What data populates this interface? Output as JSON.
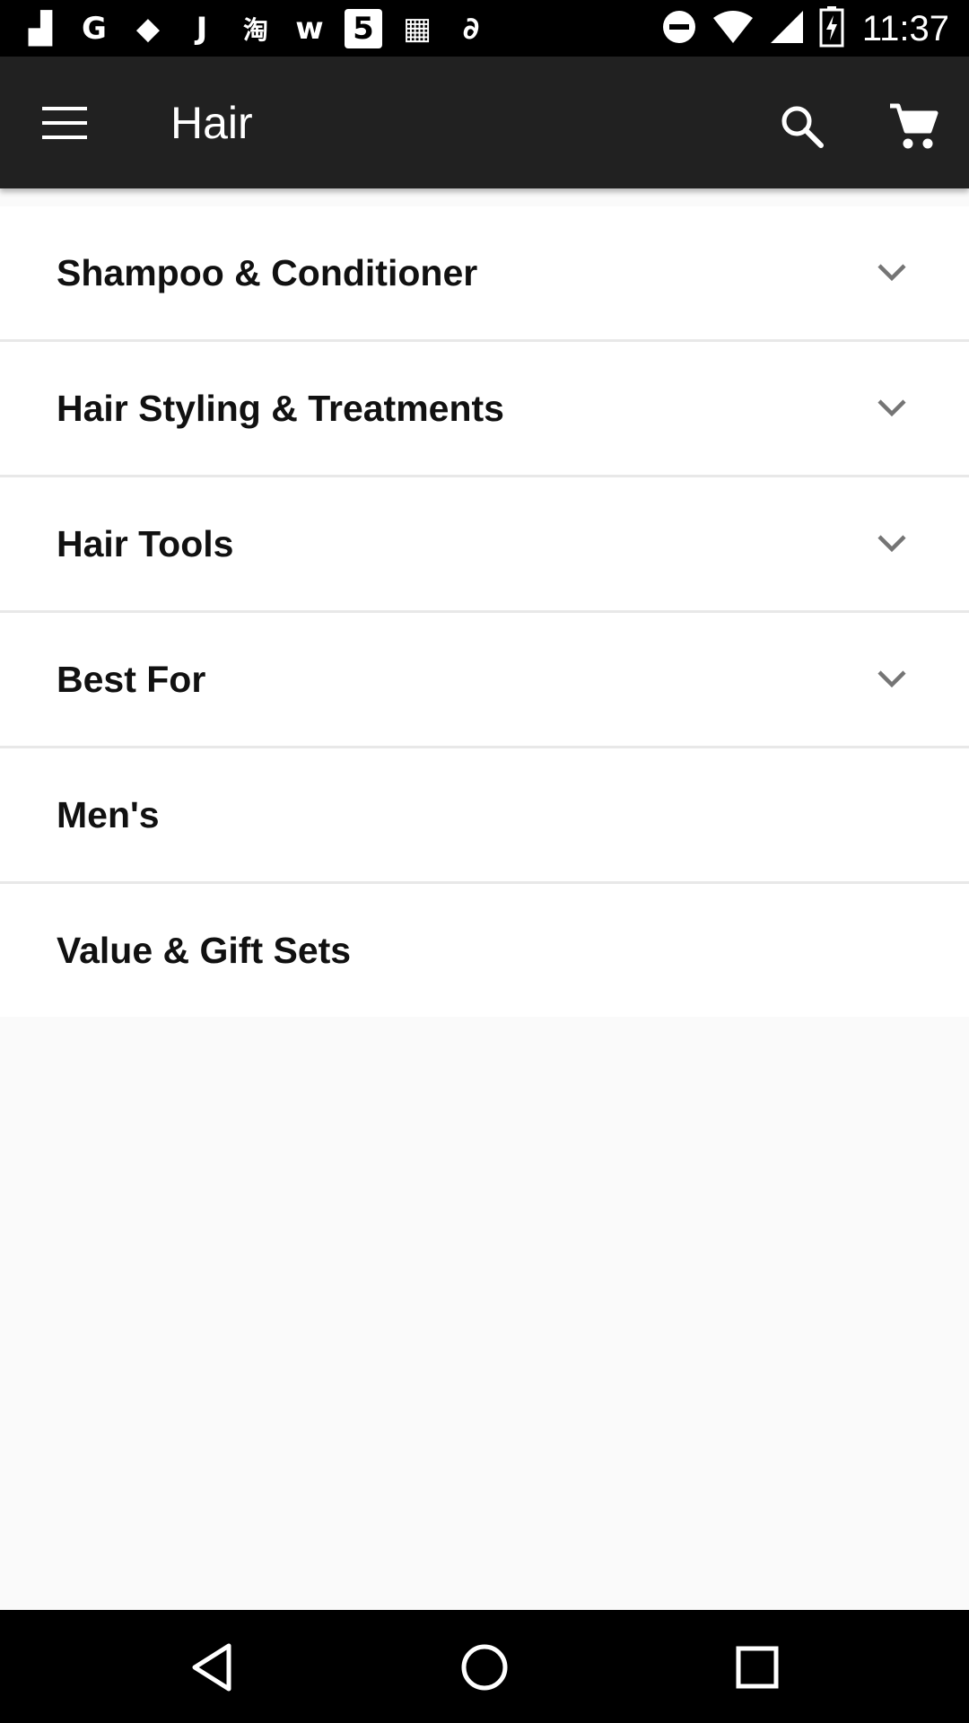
{
  "status_bar": {
    "time": "11:37",
    "left_icons": [
      "notification-app-icon",
      "google-icon",
      "drive-icon",
      "j-icon",
      "taobao-icon",
      "w-icon",
      "five-icon",
      "grid-icon",
      "link-icon"
    ],
    "left_glyphs": [
      "▟",
      "G",
      "◆",
      "J",
      "淘",
      "w",
      "5",
      "▦",
      "∂"
    ],
    "right_icons": [
      "do-not-disturb-icon",
      "wifi-icon",
      "signal-icon",
      "battery-charging-icon"
    ]
  },
  "toolbar": {
    "title": "Hair"
  },
  "categories": [
    {
      "label": "Shampoo & Conditioner",
      "expandable": true
    },
    {
      "label": "Hair Styling & Treatments",
      "expandable": true
    },
    {
      "label": "Hair Tools",
      "expandable": true
    },
    {
      "label": "Best For",
      "expandable": true
    },
    {
      "label": "Men's",
      "expandable": false
    },
    {
      "label": "Value & Gift Sets",
      "expandable": false
    }
  ],
  "colors": {
    "toolbar_bg": "#212121",
    "status_bar_bg": "#000000",
    "list_bg": "#ffffff",
    "page_bg": "#fafafa",
    "divider": "#e8e8e8",
    "chevron": "#757575"
  }
}
